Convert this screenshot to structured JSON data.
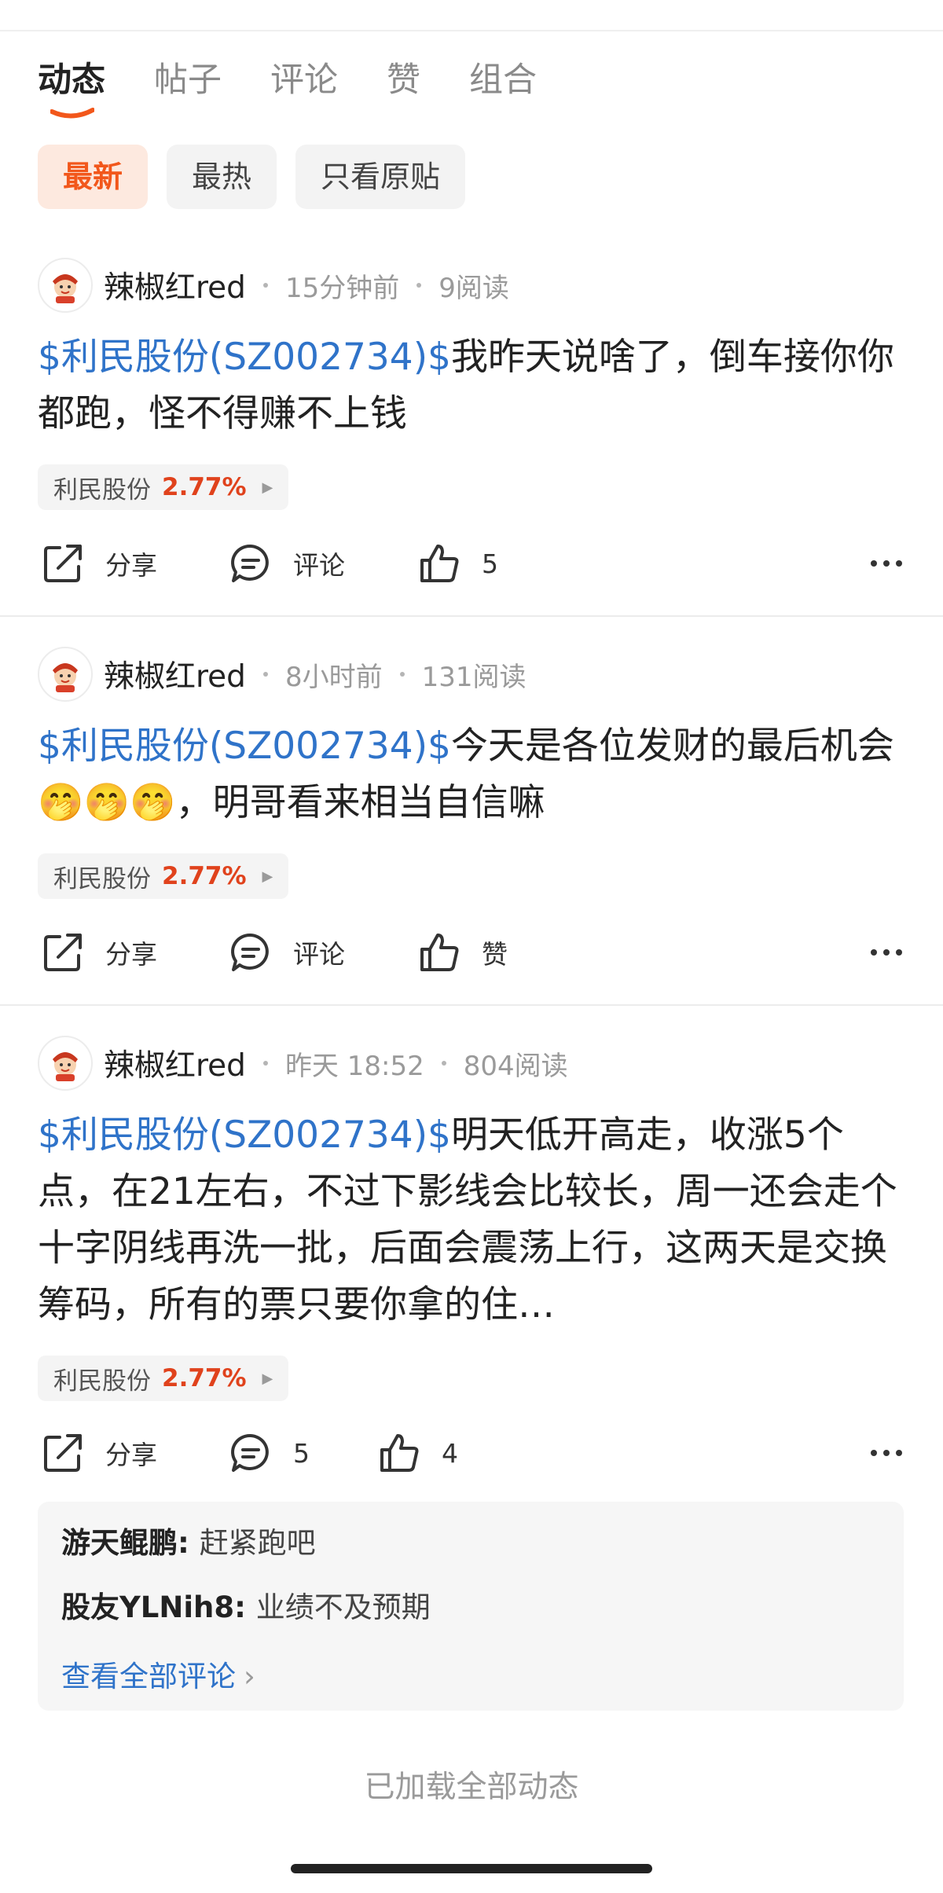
{
  "tabs": [
    {
      "label": "动态",
      "active": true
    },
    {
      "label": "帖子",
      "active": false
    },
    {
      "label": "评论",
      "active": false
    },
    {
      "label": "赞",
      "active": false
    },
    {
      "label": "组合",
      "active": false
    }
  ],
  "filters": [
    {
      "label": "最新",
      "active": true
    },
    {
      "label": "最热",
      "active": false
    },
    {
      "label": "只看原贴",
      "active": false
    }
  ],
  "posts": [
    {
      "username": "辣椒红red",
      "time": "15分钟前",
      "reads": "9阅读",
      "stock_link": "$利民股份(SZ002734)$",
      "text": "我昨天说啥了，倒车接你你都跑，怪不得赚不上钱",
      "stock_tag": {
        "name": "利民股份",
        "change": "2.77%"
      },
      "actions": {
        "share": "分享",
        "comment": "评论",
        "like": "5"
      }
    },
    {
      "username": "辣椒红red",
      "time": "8小时前",
      "reads": "131阅读",
      "stock_link": "$利民股份(SZ002734)$",
      "text_a": "今天是各位发财的最后机会",
      "emoji": [
        "🤭",
        "🤭",
        "🤭"
      ],
      "text_b": "，明哥看来相当自信嘛",
      "stock_tag": {
        "name": "利民股份",
        "change": "2.77%"
      },
      "actions": {
        "share": "分享",
        "comment": "评论",
        "like": "赞"
      }
    },
    {
      "username": "辣椒红red",
      "time": "昨天 18:52",
      "reads": "804阅读",
      "stock_link": "$利民股份(SZ002734)$",
      "text": "明天低开高走，收涨5个点，在21左右，不过下影线会比较长，周一还会走个十字阴线再洗一批，后面会震荡上行，这两天是交换筹码，所有的票只要你拿的住…",
      "stock_tag": {
        "name": "利民股份",
        "change": "2.77%"
      },
      "actions": {
        "share": "分享",
        "comment": "5",
        "like": "4"
      },
      "comments": [
        {
          "user": "游天鲲鹏",
          "sep": ": ",
          "text": "赶紧跑吧"
        },
        {
          "user": "股友YLNih8",
          "sep": ": ",
          "text": "业绩不及预期"
        }
      ],
      "view_all": "查看全部评论"
    }
  ],
  "footer": "已加载全部动态",
  "colors": {
    "accent": "#f2571b",
    "link": "#2f73c9",
    "up": "#e0421c"
  },
  "icons": [
    "share-icon",
    "comment-icon",
    "like-icon",
    "more-icon",
    "chevron-right-icon",
    "avatar-icon"
  ]
}
